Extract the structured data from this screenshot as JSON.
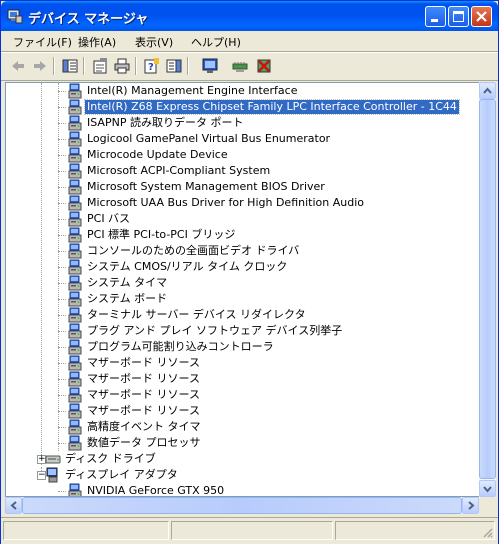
{
  "window": {
    "title": "デバイス マネージャ",
    "buttons": {
      "minimize": "minimize",
      "maximize": "maximize",
      "close": "close"
    }
  },
  "menu": [
    {
      "label": "ファイル(F)"
    },
    {
      "label": "操作(A)"
    },
    {
      "label": "表示(V)"
    },
    {
      "label": "ヘルプ(H)"
    }
  ],
  "toolbar": {
    "buttons": [
      "back-icon",
      "forward-icon",
      "show-hide-console-tree-icon",
      "properties-icon",
      "print-icon",
      "help-icon",
      "show-hide-action-pane-icon",
      "scan-hardware-icon",
      "update-driver-icon",
      "uninstall-icon"
    ]
  },
  "tree": {
    "items": [
      {
        "label": "Intel(R) Management Engine Interface",
        "level": 2
      },
      {
        "label": "Intel(R) Z68 Express Chipset Family LPC Interface Controller - 1C44",
        "level": 2,
        "selected": true
      },
      {
        "label": "ISAPNP 読み取りデータ ポート",
        "level": 2
      },
      {
        "label": "Logicool GamePanel Virtual Bus Enumerator",
        "level": 2
      },
      {
        "label": "Microcode Update Device",
        "level": 2
      },
      {
        "label": "Microsoft ACPI-Compliant System",
        "level": 2
      },
      {
        "label": "Microsoft System Management BIOS Driver",
        "level": 2
      },
      {
        "label": "Microsoft UAA Bus Driver for High Definition Audio",
        "level": 2
      },
      {
        "label": "PCI バス",
        "level": 2
      },
      {
        "label": "PCI 標準 PCI-to-PCI ブリッジ",
        "level": 2
      },
      {
        "label": "コンソールのための全画面ビデオ ドライバ",
        "level": 2
      },
      {
        "label": "システム CMOS/リアル タイム クロック",
        "level": 2
      },
      {
        "label": "システム タイマ",
        "level": 2
      },
      {
        "label": "システム ボード",
        "level": 2
      },
      {
        "label": "ターミナル サーバー デバイス リダイレクタ",
        "level": 2
      },
      {
        "label": "プラグ アンド プレイ ソフトウェア デバイス列挙子",
        "level": 2
      },
      {
        "label": "プログラム可能割り込みコントローラ",
        "level": 2
      },
      {
        "label": "マザーボード リソース",
        "level": 2
      },
      {
        "label": "マザーボード リソース",
        "level": 2
      },
      {
        "label": "マザーボード リソース",
        "level": 2
      },
      {
        "label": "マザーボード リソース",
        "level": 2
      },
      {
        "label": "高精度イベント タイマ",
        "level": 2
      },
      {
        "label": "数値データ プロセッサ",
        "level": 2
      },
      {
        "label": "ディスク ドライブ",
        "level": 1,
        "expander": "+"
      },
      {
        "label": "ディスプレイ アダプタ",
        "level": 1,
        "expander": "-"
      },
      {
        "label": "NVIDIA GeForce GTX 950",
        "level": 2
      }
    ]
  },
  "colors": {
    "titlebar": "#0054e3",
    "selection": "#316ac5",
    "face": "#ece9d8"
  }
}
